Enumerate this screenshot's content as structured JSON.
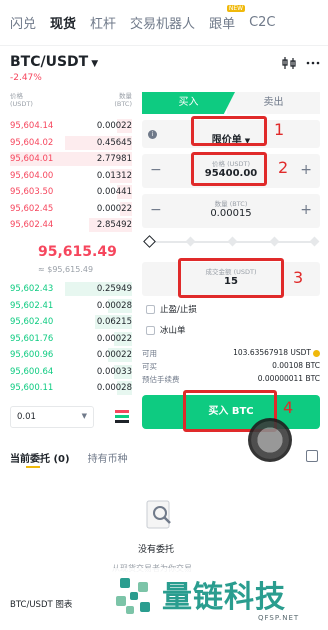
{
  "topnav": {
    "tabs": [
      "闪兑",
      "现货",
      "杠杆",
      "交易机器人",
      "跟单",
      "C2C"
    ],
    "active_index": 1,
    "new_badge": "NEW"
  },
  "pair": {
    "symbol": "BTC/USDT",
    "caret": "▼",
    "change": "-2.47%"
  },
  "orderbook": {
    "header_left": [
      "价格",
      "(USDT)"
    ],
    "header_right": [
      "数量",
      "(BTC)"
    ],
    "asks": [
      {
        "price": "95,604.14",
        "qty": "0.00022",
        "depth": 0.12
      },
      {
        "price": "95,604.02",
        "qty": "0.45645",
        "depth": 0.55
      },
      {
        "price": "95,604.01",
        "qty": "2.77981",
        "depth": 1.0
      },
      {
        "price": "95,604.00",
        "qty": "0.01312",
        "depth": 0.18
      },
      {
        "price": "95,603.50",
        "qty": "0.00441",
        "depth": 0.12
      },
      {
        "price": "95,602.45",
        "qty": "0.00022",
        "depth": 0.1
      },
      {
        "price": "95,602.44",
        "qty": "2.85492",
        "depth": 0.35
      }
    ],
    "mid_price": "95,615.49",
    "mid_sub": "≈ $95,615.49",
    "bids": [
      {
        "price": "95,602.43",
        "qty": "0.25949",
        "depth": 0.55
      },
      {
        "price": "95,602.41",
        "qty": "0.00028",
        "depth": 0.2
      },
      {
        "price": "95,602.40",
        "qty": "0.06215",
        "depth": 0.3
      },
      {
        "price": "95,601.76",
        "qty": "0.00022",
        "depth": 0.15
      },
      {
        "price": "95,600.96",
        "qty": "0.00022",
        "depth": 0.2
      },
      {
        "price": "95,600.64",
        "qty": "0.00033",
        "depth": 0.15
      },
      {
        "price": "95,600.11",
        "qty": "0.00028",
        "depth": 0.12
      }
    ],
    "depth_select": "0.01"
  },
  "form": {
    "buy_tab": "买入",
    "sell_tab": "卖出",
    "order_type": "限价单",
    "price_label": "价格 (USDT)",
    "price_value": "95400.00",
    "amount_label": "数量 (BTC)",
    "amount_value": "0.00015",
    "total_label": "成交金额 (USDT)",
    "total_value": "15",
    "tp_sl": "止盈/止损",
    "iceberg": "冰山单",
    "available_label": "可用",
    "available_value": "103.63567918 USDT",
    "can_buy_label": "可买",
    "can_buy_value": "0.00108 BTC",
    "fee_label": "预估手续费",
    "fee_value": "0.00000011 BTC",
    "buy_button": "买入 BTC"
  },
  "annotations": [
    "1",
    "2",
    "3",
    "4"
  ],
  "bottom": {
    "tab_open": "当前委托 (0)",
    "tab_holdings": "持有币种",
    "empty_title": "没有委托",
    "empty_sub": "从现货交易者为你交易",
    "chart_link": "BTC/USDT 图表"
  },
  "watermark": {
    "name": "量链科技",
    "url": "QFSP.NET"
  },
  "colors": {
    "buy": "#0ecb81",
    "sell": "#f6465d",
    "annotation": "#e02a2a",
    "brand": "#f0b90b"
  }
}
